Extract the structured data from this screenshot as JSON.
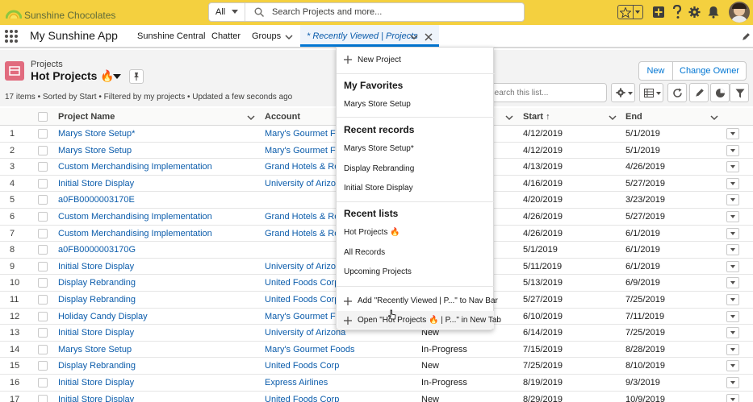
{
  "brand": {
    "name": "Sunshine Chocolates"
  },
  "search": {
    "scope": "All",
    "placeholder": "Search Projects and more..."
  },
  "nav": {
    "app_name": "My Sunshine App",
    "items": [
      "Sunshine Central",
      "Chatter",
      "Groups"
    ],
    "active_tab": "* Recently Viewed | Projects"
  },
  "header": {
    "object_label": "Projects",
    "list_title": "Hot Projects 🔥",
    "meta": "17 items • Sorted by Start • Filtered by my projects • Updated a few seconds ago",
    "buttons": {
      "new": "New",
      "change_owner": "Change Owner"
    },
    "search_placeholder": "Search this list..."
  },
  "columns": {
    "name": "Project Name",
    "account": "Account",
    "start": "Start ↑",
    "end": "End"
  },
  "rows": [
    {
      "n": "1",
      "name": "Marys Store Setup*",
      "account": "Mary's Gourmet Foods",
      "status": "",
      "start": "4/12/2019",
      "end": "5/1/2019"
    },
    {
      "n": "2",
      "name": "Marys Store Setup",
      "account": "Mary's Gourmet Foods",
      "status": "",
      "start": "4/12/2019",
      "end": "5/1/2019"
    },
    {
      "n": "3",
      "name": "Custom Merchandising Implementation",
      "account": "Grand Hotels & Resorts",
      "status": "",
      "start": "4/13/2019",
      "end": "4/26/2019"
    },
    {
      "n": "4",
      "name": "Initial Store Display",
      "account": "University of Arizona",
      "status": "",
      "start": "4/16/2019",
      "end": "5/27/2019"
    },
    {
      "n": "5",
      "name": "a0FB0000003170E",
      "account": "",
      "status": "",
      "start": "4/20/2019",
      "end": "3/23/2019"
    },
    {
      "n": "6",
      "name": "Custom Merchandising Implementation",
      "account": "Grand Hotels & Resorts",
      "status": "",
      "start": "4/26/2019",
      "end": "5/27/2019"
    },
    {
      "n": "7",
      "name": "Custom Merchandising Implementation",
      "account": "Grand Hotels & Resorts",
      "status": "",
      "start": "4/26/2019",
      "end": "6/1/2019"
    },
    {
      "n": "8",
      "name": "a0FB0000003170G",
      "account": "",
      "status": "",
      "start": "5/1/2019",
      "end": "6/1/2019"
    },
    {
      "n": "9",
      "name": "Initial Store Display",
      "account": "University of Arizona",
      "status": "",
      "start": "5/11/2019",
      "end": "6/1/2019"
    },
    {
      "n": "10",
      "name": "Display Rebranding",
      "account": "United Foods Corp",
      "status": "",
      "start": "5/13/2019",
      "end": "6/9/2019"
    },
    {
      "n": "11",
      "name": "Display Rebranding",
      "account": "United Foods Corp",
      "status": "",
      "start": "5/27/2019",
      "end": "7/25/2019"
    },
    {
      "n": "12",
      "name": "Holiday Candy Display",
      "account": "Mary's Gourmet Foods",
      "status": "",
      "start": "6/10/2019",
      "end": "7/11/2019"
    },
    {
      "n": "13",
      "name": "Initial Store Display",
      "account": "University of Arizona",
      "status": "New",
      "start": "6/14/2019",
      "end": "7/25/2019"
    },
    {
      "n": "14",
      "name": "Marys Store Setup",
      "account": "Mary's Gourmet Foods",
      "status": "In-Progress",
      "start": "7/15/2019",
      "end": "8/28/2019"
    },
    {
      "n": "15",
      "name": "Display Rebranding",
      "account": "United Foods Corp",
      "status": "New",
      "start": "7/25/2019",
      "end": "8/10/2019"
    },
    {
      "n": "16",
      "name": "Initial Store Display",
      "account": "Express Airlines",
      "status": "In-Progress",
      "start": "8/19/2019",
      "end": "9/3/2019"
    },
    {
      "n": "17",
      "name": "Initial Store Display",
      "account": "United Foods Corp",
      "status": "New",
      "start": "8/29/2019",
      "end": "10/9/2019"
    }
  ],
  "dropdown": {
    "new_project": "New Project",
    "favorites_heading": "My Favorites",
    "favorites": [
      "Marys Store Setup"
    ],
    "recent_records_heading": "Recent records",
    "recent_records": [
      "Marys Store Setup*",
      "Display Rebranding",
      "Initial Store Display"
    ],
    "recent_lists_heading": "Recent lists",
    "recent_lists": [
      "Hot Projects 🔥",
      "All Records",
      "Upcoming Projects"
    ],
    "add_to_nav": "Add \"Recently Viewed | P...\" to Nav Bar",
    "open_new_tab": "Open \"Hot Projects 🔥 | P...\" in New Tab"
  },
  "colors": {
    "topbar": "#f4d03f",
    "link": "#0b5cab",
    "accent": "#0176d3"
  }
}
